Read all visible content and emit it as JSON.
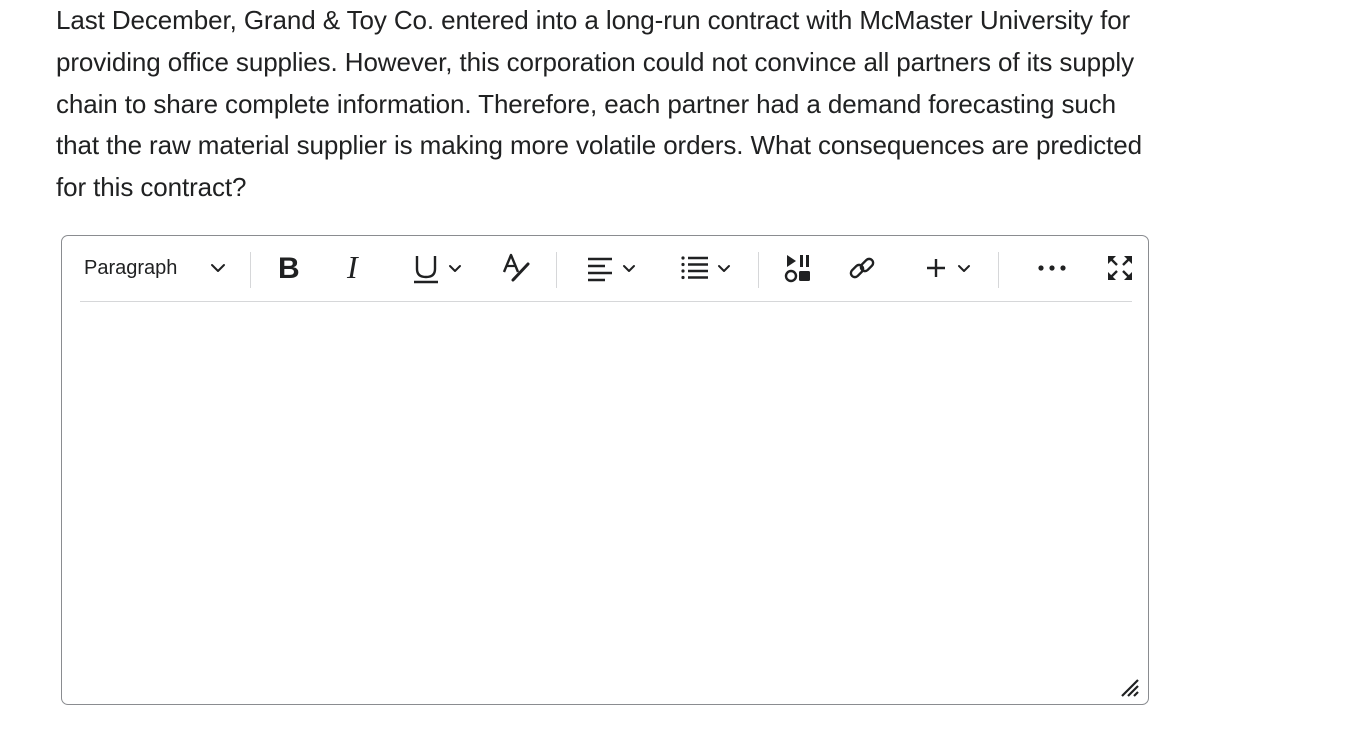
{
  "question": {
    "text": "Last December, Grand & Toy Co. entered into a long-run contract with McMaster University for providing office supplies. However, this corporation could not convince all partners of its supply chain to share complete information. Therefore, each partner had a demand forecasting such that the raw material supplier is making more volatile orders. What consequences are predicted for this contract?"
  },
  "editor": {
    "block_format": "Paragraph",
    "body_text": "",
    "toolbar_icons": [
      "chevron-down-icon",
      "bold-icon",
      "italic-icon",
      "underline-icon",
      "strikethrough-format-icon",
      "align-left-icon",
      "bullet-list-icon",
      "media-icon",
      "link-icon",
      "plus-icon",
      "more-icon",
      "fullscreen-icon",
      "resize-icon"
    ]
  },
  "colors": {
    "text": "#202122",
    "border": "#8a8c90",
    "divider": "#d6d7d9"
  }
}
